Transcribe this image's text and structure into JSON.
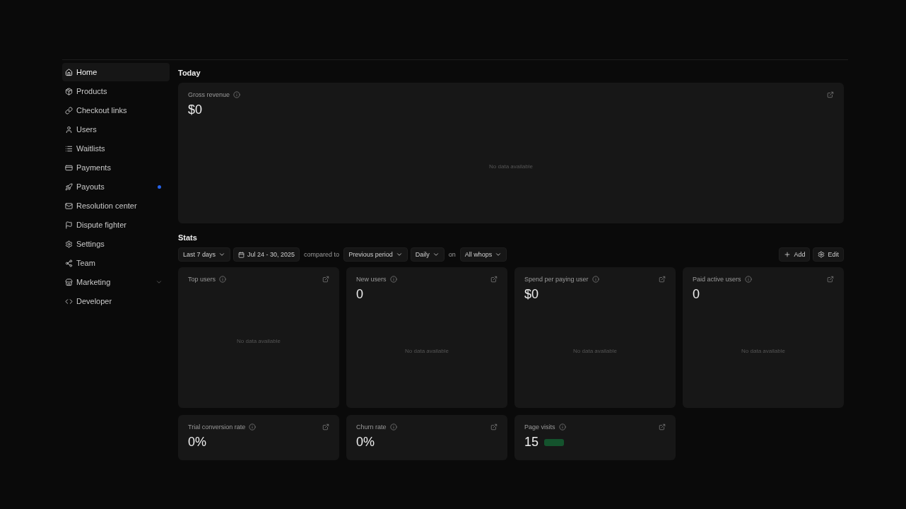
{
  "sidebar": {
    "items": [
      {
        "label": "Home",
        "selected": true
      },
      {
        "label": "Products",
        "selected": false
      },
      {
        "label": "Checkout links",
        "selected": false
      },
      {
        "label": "Users",
        "selected": false
      },
      {
        "label": "Waitlists",
        "selected": false
      },
      {
        "label": "Payments",
        "selected": false
      },
      {
        "label": "Payouts",
        "selected": false,
        "notification": true
      },
      {
        "label": "Resolution center",
        "selected": false
      },
      {
        "label": "Dispute fighter",
        "selected": false
      },
      {
        "label": "Settings",
        "selected": false
      },
      {
        "label": "Team",
        "selected": false
      },
      {
        "label": "Marketing",
        "selected": false,
        "expanded": false
      },
      {
        "label": "Developer",
        "selected": false
      }
    ]
  },
  "today": {
    "title": "Today",
    "card": {
      "title": "Gross revenue",
      "value": "$0",
      "empty_text": "No data available"
    }
  },
  "stats": {
    "title": "Stats",
    "filters": [
      {
        "kind": "dropdown",
        "label": "Last 7 days"
      },
      {
        "kind": "date",
        "label": "Jul 24 - 30, 2025"
      },
      {
        "kind": "text",
        "label": "compared to"
      },
      {
        "kind": "dropdown",
        "label": "Previous period"
      },
      {
        "kind": "dropdown",
        "label": "Daily"
      },
      {
        "kind": "text",
        "label": "on"
      },
      {
        "kind": "dropdown",
        "label": "All whops"
      }
    ],
    "actions": [
      {
        "kind": "add",
        "label": "Add"
      },
      {
        "kind": "edit",
        "label": "Edit"
      }
    ],
    "cards": [
      {
        "title": "Top users",
        "empty_text": "No data available"
      },
      {
        "title": "New users",
        "value": "0",
        "empty_text": "No data available"
      },
      {
        "title": "Spend per paying user",
        "value": "$0",
        "empty_text": "No data available"
      },
      {
        "title": "Paid active users",
        "value": "0",
        "empty_text": "No data available"
      },
      {
        "title": "Trial conversion rate",
        "value": "0%"
      },
      {
        "title": "Churn rate",
        "value": "0%"
      },
      {
        "title": "Page visits",
        "value": "15",
        "badge": true
      }
    ]
  }
}
